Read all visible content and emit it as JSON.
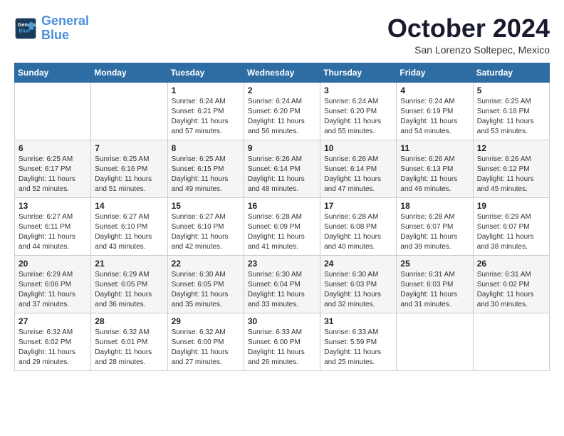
{
  "header": {
    "logo_line1": "General",
    "logo_line2": "Blue",
    "month_title": "October 2024",
    "subtitle": "San Lorenzo Soltepec, Mexico"
  },
  "days_of_week": [
    "Sunday",
    "Monday",
    "Tuesday",
    "Wednesday",
    "Thursday",
    "Friday",
    "Saturday"
  ],
  "weeks": [
    [
      {
        "day": "",
        "info": ""
      },
      {
        "day": "",
        "info": ""
      },
      {
        "day": "1",
        "info": "Sunrise: 6:24 AM\nSunset: 6:21 PM\nDaylight: 11 hours and 57 minutes."
      },
      {
        "day": "2",
        "info": "Sunrise: 6:24 AM\nSunset: 6:20 PM\nDaylight: 11 hours and 56 minutes."
      },
      {
        "day": "3",
        "info": "Sunrise: 6:24 AM\nSunset: 6:20 PM\nDaylight: 11 hours and 55 minutes."
      },
      {
        "day": "4",
        "info": "Sunrise: 6:24 AM\nSunset: 6:19 PM\nDaylight: 11 hours and 54 minutes."
      },
      {
        "day": "5",
        "info": "Sunrise: 6:25 AM\nSunset: 6:18 PM\nDaylight: 11 hours and 53 minutes."
      }
    ],
    [
      {
        "day": "6",
        "info": "Sunrise: 6:25 AM\nSunset: 6:17 PM\nDaylight: 11 hours and 52 minutes."
      },
      {
        "day": "7",
        "info": "Sunrise: 6:25 AM\nSunset: 6:16 PM\nDaylight: 11 hours and 51 minutes."
      },
      {
        "day": "8",
        "info": "Sunrise: 6:25 AM\nSunset: 6:15 PM\nDaylight: 11 hours and 49 minutes."
      },
      {
        "day": "9",
        "info": "Sunrise: 6:26 AM\nSunset: 6:14 PM\nDaylight: 11 hours and 48 minutes."
      },
      {
        "day": "10",
        "info": "Sunrise: 6:26 AM\nSunset: 6:14 PM\nDaylight: 11 hours and 47 minutes."
      },
      {
        "day": "11",
        "info": "Sunrise: 6:26 AM\nSunset: 6:13 PM\nDaylight: 11 hours and 46 minutes."
      },
      {
        "day": "12",
        "info": "Sunrise: 6:26 AM\nSunset: 6:12 PM\nDaylight: 11 hours and 45 minutes."
      }
    ],
    [
      {
        "day": "13",
        "info": "Sunrise: 6:27 AM\nSunset: 6:11 PM\nDaylight: 11 hours and 44 minutes."
      },
      {
        "day": "14",
        "info": "Sunrise: 6:27 AM\nSunset: 6:10 PM\nDaylight: 11 hours and 43 minutes."
      },
      {
        "day": "15",
        "info": "Sunrise: 6:27 AM\nSunset: 6:10 PM\nDaylight: 11 hours and 42 minutes."
      },
      {
        "day": "16",
        "info": "Sunrise: 6:28 AM\nSunset: 6:09 PM\nDaylight: 11 hours and 41 minutes."
      },
      {
        "day": "17",
        "info": "Sunrise: 6:28 AM\nSunset: 6:08 PM\nDaylight: 11 hours and 40 minutes."
      },
      {
        "day": "18",
        "info": "Sunrise: 6:28 AM\nSunset: 6:07 PM\nDaylight: 11 hours and 39 minutes."
      },
      {
        "day": "19",
        "info": "Sunrise: 6:29 AM\nSunset: 6:07 PM\nDaylight: 11 hours and 38 minutes."
      }
    ],
    [
      {
        "day": "20",
        "info": "Sunrise: 6:29 AM\nSunset: 6:06 PM\nDaylight: 11 hours and 37 minutes."
      },
      {
        "day": "21",
        "info": "Sunrise: 6:29 AM\nSunset: 6:05 PM\nDaylight: 11 hours and 36 minutes."
      },
      {
        "day": "22",
        "info": "Sunrise: 6:30 AM\nSunset: 6:05 PM\nDaylight: 11 hours and 35 minutes."
      },
      {
        "day": "23",
        "info": "Sunrise: 6:30 AM\nSunset: 6:04 PM\nDaylight: 11 hours and 33 minutes."
      },
      {
        "day": "24",
        "info": "Sunrise: 6:30 AM\nSunset: 6:03 PM\nDaylight: 11 hours and 32 minutes."
      },
      {
        "day": "25",
        "info": "Sunrise: 6:31 AM\nSunset: 6:03 PM\nDaylight: 11 hours and 31 minutes."
      },
      {
        "day": "26",
        "info": "Sunrise: 6:31 AM\nSunset: 6:02 PM\nDaylight: 11 hours and 30 minutes."
      }
    ],
    [
      {
        "day": "27",
        "info": "Sunrise: 6:32 AM\nSunset: 6:02 PM\nDaylight: 11 hours and 29 minutes."
      },
      {
        "day": "28",
        "info": "Sunrise: 6:32 AM\nSunset: 6:01 PM\nDaylight: 11 hours and 28 minutes."
      },
      {
        "day": "29",
        "info": "Sunrise: 6:32 AM\nSunset: 6:00 PM\nDaylight: 11 hours and 27 minutes."
      },
      {
        "day": "30",
        "info": "Sunrise: 6:33 AM\nSunset: 6:00 PM\nDaylight: 11 hours and 26 minutes."
      },
      {
        "day": "31",
        "info": "Sunrise: 6:33 AM\nSunset: 5:59 PM\nDaylight: 11 hours and 25 minutes."
      },
      {
        "day": "",
        "info": ""
      },
      {
        "day": "",
        "info": ""
      }
    ]
  ]
}
